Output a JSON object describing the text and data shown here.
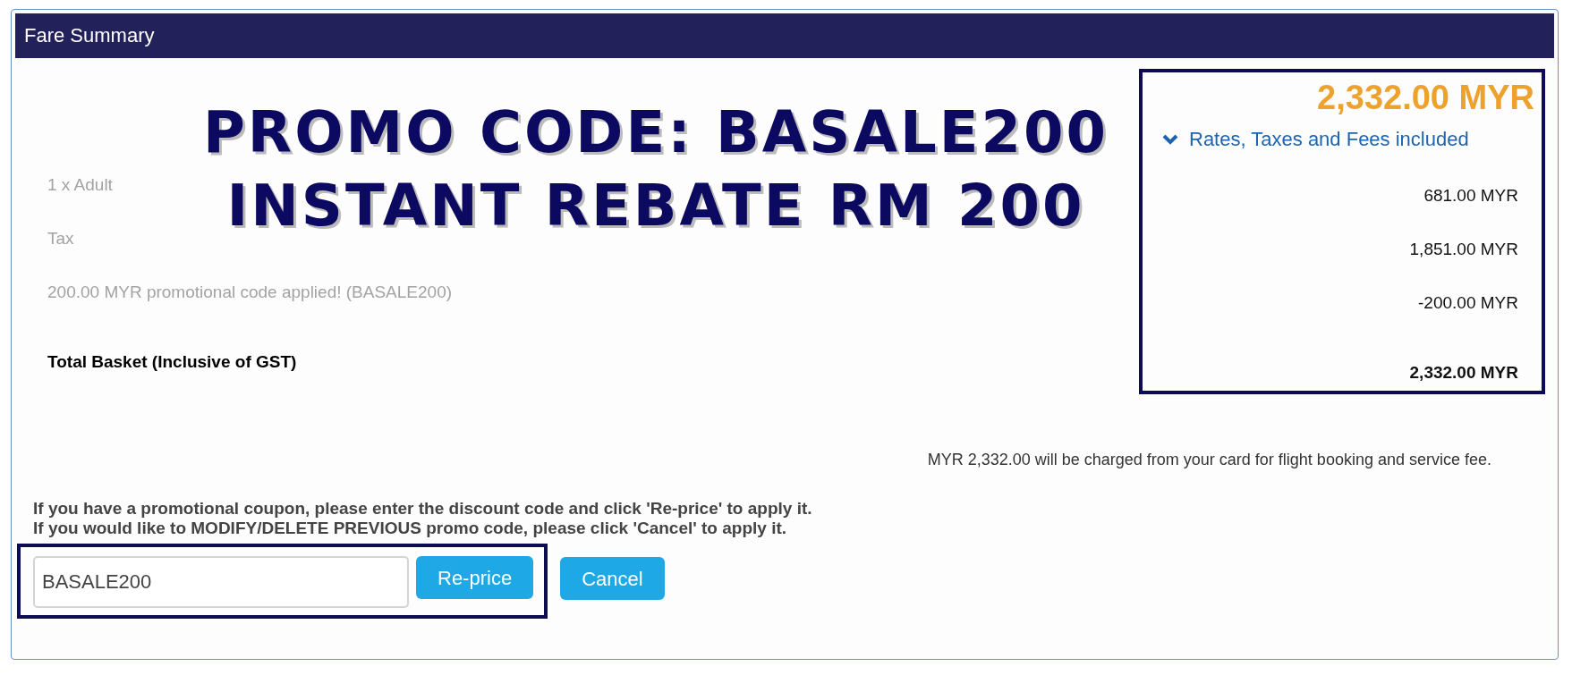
{
  "panel": {
    "title": "Fare Summary"
  },
  "annotation": {
    "lines": [
      "PROMO CODE: BASALE200",
      "INSTANT REBATE RM 200"
    ]
  },
  "summary": {
    "total": "2,332.00 MYR",
    "breakdown_toggle": {
      "label": "Rates, Taxes and Fees included",
      "expanded": true
    }
  },
  "lines": [
    {
      "kind": "item",
      "label": "1 x Adult",
      "amount": "681.00 MYR"
    },
    {
      "kind": "item",
      "label": "Tax",
      "amount": "1,851.00 MYR"
    },
    {
      "kind": "item",
      "label": "200.00 MYR promotional code applied! (BASALE200)",
      "amount": "-200.00 MYR"
    },
    {
      "kind": "total",
      "label": "Total Basket (Inclusive of GST)",
      "amount": "2,332.00 MYR"
    }
  ],
  "charge_note": "MYR 2,332.00 will be charged from your card for flight booking and service fee.",
  "instructions": [
    "If you have a promotional coupon, please enter the discount code and click 'Re-price' to apply it.",
    "If you would like to MODIFY/DELETE PREVIOUS promo code, please click 'Cancel' to apply it."
  ],
  "promo": {
    "value": "BASALE200"
  },
  "buttons": [
    {
      "label": "Re-price",
      "kind": "primary"
    },
    {
      "label": "Cancel",
      "kind": "primary"
    }
  ]
}
